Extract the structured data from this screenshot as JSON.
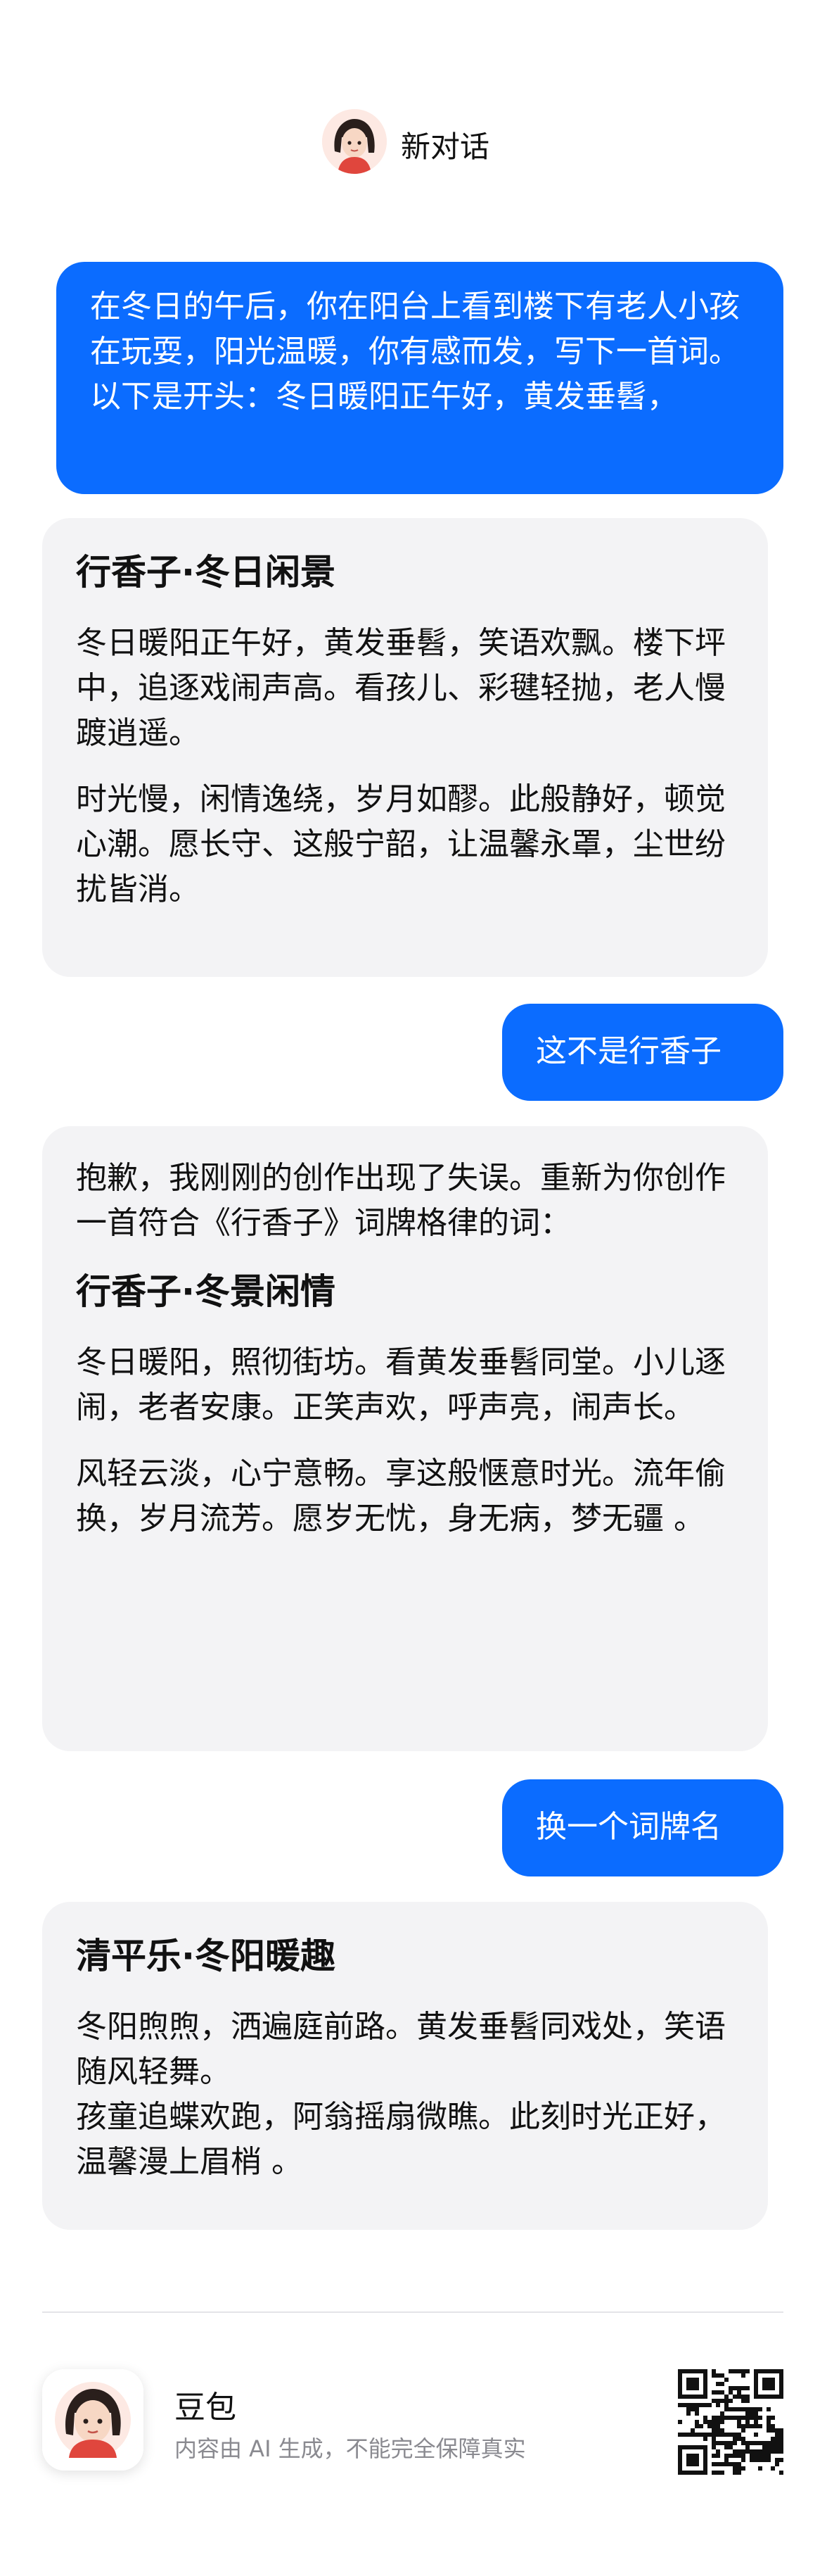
{
  "header": {
    "title": "新对话"
  },
  "messages": {
    "user1": {
      "text": "在冬日的午后，你在阳台上看到楼下有老人小孩在玩耍，阳光温暖，你有感而发，写下一首词。以下是开头：冬日暖阳正午好，黄发垂髫，"
    },
    "bot1": {
      "title": "行香子·冬日闲景",
      "p1": "冬日暖阳正午好，黄发垂髫，笑语欢飘。楼下坪中，追逐戏闹声高。看孩儿、彩毽轻抛，老人慢踱逍遥。",
      "p2": "时光慢，闲情逸绕，岁月如醪。此般静好，顿觉心潮。愿长守、这般宁韶，让温馨永罩，尘世纷扰皆消。"
    },
    "user2": {
      "text": "这不是行香子"
    },
    "bot2": {
      "intro": "抱歉，我刚刚的创作出现了失误。重新为你创作一首符合《行香子》词牌格律的词：",
      "title": "行香子·冬景闲情",
      "p1": "冬日暖阳，照彻街坊。看黄发垂髫同堂。小儿逐闹，老者安康。正笑声欢，呼声亮，闹声长。",
      "p2": "风轻云淡，心宁意畅。享这般惬意时光。流年偷换，岁月流芳。愿岁无忧，身无病，梦无疆 。"
    },
    "user3": {
      "text": "换一个词牌名"
    },
    "bot3": {
      "title": "清平乐·冬阳暖趣",
      "p1": "冬阳煦煦，洒遍庭前路。黄发垂髫同戏处，笑语随风轻舞。",
      "p2": "孩童追蝶欢跑，阿翁摇扇微瞧。此刻时光正好，温馨漫上眉梢 。"
    }
  },
  "footer": {
    "name": "豆包",
    "disclaimer": "内容由 AI 生成，不能完全保障真实"
  },
  "colors": {
    "user_bubble": "#0b6cff",
    "bot_bubble": "#f3f3f5"
  },
  "icons": {
    "avatar": "avatar-icon",
    "qr": "qr-code-icon"
  }
}
